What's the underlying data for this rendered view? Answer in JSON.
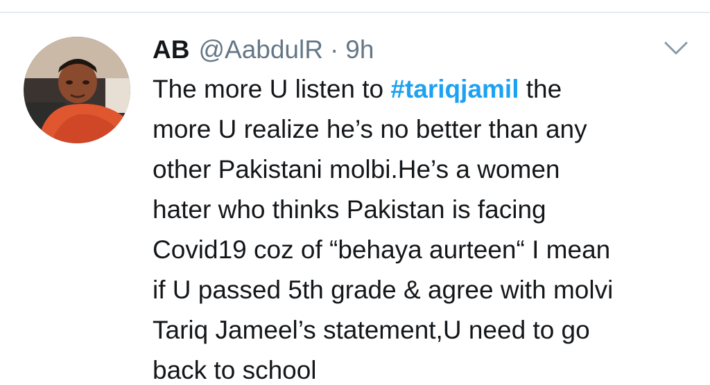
{
  "tweet": {
    "author": {
      "display_name": "AB",
      "handle": "@AabdulR"
    },
    "separator": "·",
    "timestamp": "9h",
    "caret_icon": "chevron-down-icon",
    "text": {
      "line1_before": "The more U listen to ",
      "hashtag": "#tariqjamil",
      "line1_after": " the",
      "line2": "more U realize he’s no better than any",
      "line3": "other Pakistani molbi.He’s a women",
      "line4": "hater who thinks Pakistan is facing",
      "line5": "Covid19 coz of “behaya aurteen“ I mean",
      "line6": "if U passed 5th grade & agree with molvi",
      "line7": "Tariq Jameel’s statement,U need to go",
      "line8": "back to school"
    }
  },
  "colors": {
    "text_primary": "#14171a",
    "text_secondary": "#657786",
    "hashtag": "#1da1f2",
    "divider": "#e6ecf0"
  }
}
